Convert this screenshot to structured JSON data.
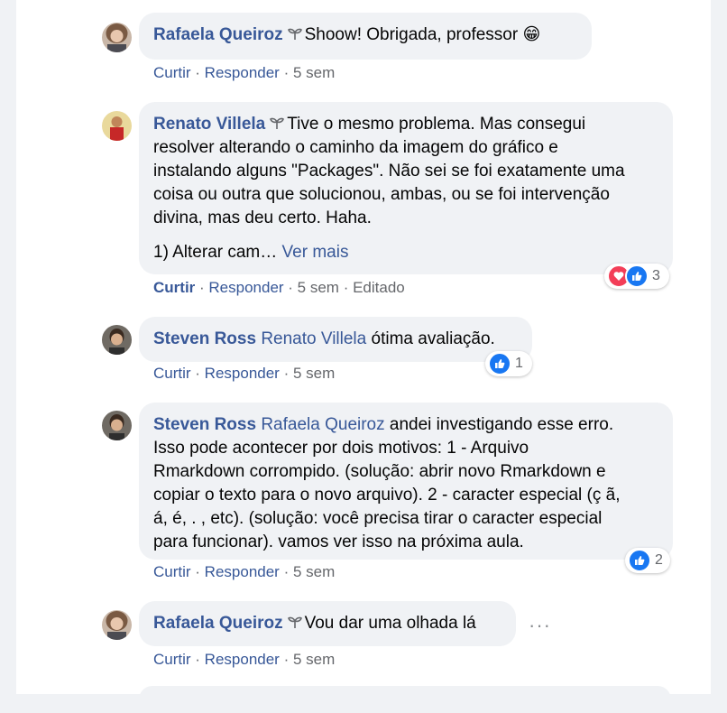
{
  "comments": [
    {
      "author": "Rafaela Queiroz",
      "mention": "",
      "text": "Shoow! Obrigada, professor",
      "emoji": "😁",
      "actions": {
        "like": "Curtir",
        "reply": "Responder",
        "time": "5 sem",
        "edited": ""
      }
    },
    {
      "author": "Renato Villela",
      "mention": "",
      "text_lines": [
        "Tive o mesmo problema. Mas consegui",
        "resolver alterando o caminho da imagem do gráfico e",
        "instalando alguns \"Packages\". Não sei se foi exatamente uma",
        "coisa ou outra que solucionou, ambas, ou se foi intervenção",
        "divina, mas deu certo. Haha."
      ],
      "truncated_line": "1) Alterar cam…",
      "see_more": "Ver mais",
      "reactions_count": "3",
      "actions": {
        "like": "Curtir",
        "reply": "Responder",
        "time": "5 sem",
        "edited": "Editado"
      }
    },
    {
      "author": "Steven Ross",
      "mention": "Renato Villela",
      "text": "ótima avaliação.",
      "reactions_count": "1",
      "actions": {
        "like": "Curtir",
        "reply": "Responder",
        "time": "5 sem"
      }
    },
    {
      "author": "Steven Ross",
      "mention": "Rafaela Queiroz",
      "text_lines": [
        "andei investigando esse erro.",
        "Isso pode acontecer por dois motivos: 1 - Arquivo",
        "Rmarkdown corrompido. (solução: abrir novo Rmarkdown e",
        "copiar o texto para o novo arquivo). 2 - caracter especial (ç ã,",
        "á, é, . , etc). (solução: você precisa tirar o caracter especial",
        "para funcionar). vamos ver isso na próxima aula."
      ],
      "reactions_count": "2",
      "actions": {
        "like": "Curtir",
        "reply": "Responder",
        "time": "5 sem"
      }
    },
    {
      "author": "Rafaela Queiroz",
      "mention": "",
      "text": "Vou dar uma olhada lá",
      "more_options": "···",
      "actions": {
        "like": "Curtir",
        "reply": "Responder",
        "time": "5 sem"
      }
    }
  ],
  "separator": " · ",
  "colors": {
    "link": "#385898",
    "meta": "#65676b",
    "bubble": "#f0f2f5",
    "like": "#1877f2",
    "love": "#f33e58"
  },
  "icons": [
    "avatar-rafaela",
    "avatar-renato",
    "avatar-steven",
    "top-fan-badge-icon",
    "like-reaction-icon",
    "love-reaction-icon",
    "more-options-icon"
  ]
}
